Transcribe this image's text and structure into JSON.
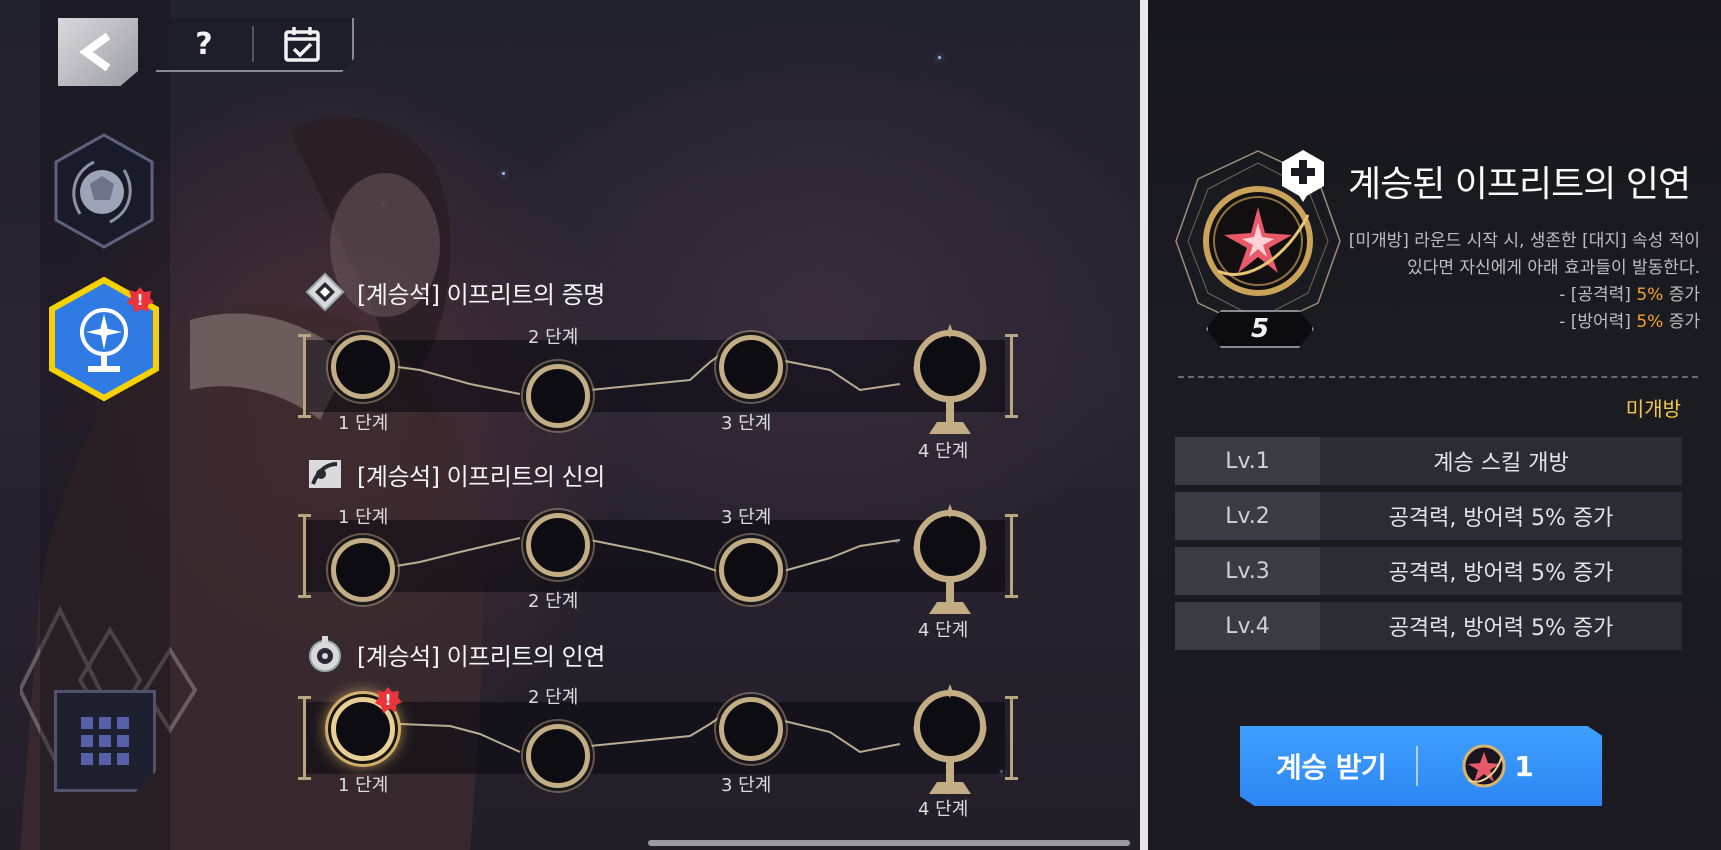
{
  "colors": {
    "accent_gold": "#c3ad84",
    "highlight_orange": "#f0a428",
    "status_yellow": "#f2c94c",
    "button_blue": "#3fa0ff",
    "alert_red": "#e8343a",
    "selected_hex_border": "#f5d100"
  },
  "toolbar": {
    "back_icon": "back-arrow-icon",
    "help_label": "?",
    "calendar_icon": "calendar-check-icon"
  },
  "sidebar": {
    "items": [
      {
        "icon": "orb-compass-icon",
        "selected": false
      },
      {
        "icon": "compass-globe-icon",
        "selected": true,
        "alert": true
      },
      {
        "icon": "grid-menu-icon"
      }
    ]
  },
  "paths": [
    {
      "title": "[계승석] 이프리트의 증명",
      "icon": "diamond-crest-icon",
      "stages": [
        "1 단계",
        "2 단계",
        "3 단계",
        "4 단계"
      ]
    },
    {
      "title": "[계승석] 이프리트의 신의",
      "icon": "scroll-emblem-icon",
      "stages": [
        "1 단계",
        "2 단계",
        "3 단계",
        "4 단계"
      ]
    },
    {
      "title": "[계승석] 이프리트의 인연",
      "icon": "compass-medal-icon",
      "stages": [
        "1 단계",
        "2 단계",
        "3 단계",
        "4 단계"
      ],
      "active_stage_alert": true
    }
  ],
  "detail": {
    "title": "계승된 이프리트의 인연",
    "level": "5",
    "description": "[미개방] 라운드 시작 시, 생존한 [대지] 속성 적이 있다면 자신에게 아래 효과들이 발동한다.",
    "effects": [
      {
        "prefix": "- [공격력] ",
        "value": "5%",
        "suffix": " 증가"
      },
      {
        "prefix": "- [방어력] ",
        "value": "5%",
        "suffix": " 증가"
      }
    ],
    "status": "미개방",
    "levels": [
      {
        "lv": "Lv.1",
        "text": "계승 스킬 개방"
      },
      {
        "lv": "Lv.2",
        "text": "공격력, 방어력 5% 증가"
      },
      {
        "lv": "Lv.3",
        "text": "공격력, 방어력 5% 증가"
      },
      {
        "lv": "Lv.4",
        "text": "공격력, 방어력 5% 증가"
      }
    ],
    "button": {
      "label": "계승 받기",
      "cost_icon": "inherit-stone-icon",
      "cost": "1"
    }
  }
}
